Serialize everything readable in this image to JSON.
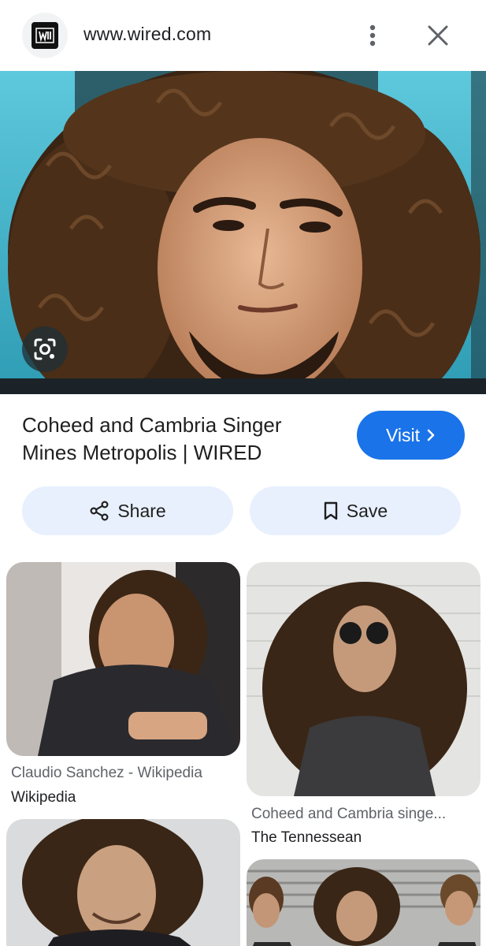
{
  "header": {
    "site_url": "www.wired.com",
    "favicon_icon": "wired-logo-icon",
    "menu_icon": "more-vert-icon",
    "close_icon": "close-icon"
  },
  "hero": {
    "lens_icon": "google-lens-icon"
  },
  "result": {
    "title": "Coheed and Cambria Singer Mines Metropolis | WIRED",
    "visit_label": "Visit",
    "visit_icon": "chevron-right-icon"
  },
  "actions": {
    "share_label": "Share",
    "share_icon": "share-icon",
    "save_label": "Save",
    "save_icon": "bookmark-icon"
  },
  "related": [
    {
      "title": "Claudio Sanchez - Wikipedia",
      "source": "Wikipedia"
    },
    {
      "title": "Coheed and Cambria singe...",
      "source": "The Tennessean"
    },
    {
      "title": "",
      "source": ""
    },
    {
      "title": "",
      "source": ""
    }
  ],
  "colors": {
    "accent": "#1a73e8",
    "pill_bg": "#e8f0fe"
  }
}
